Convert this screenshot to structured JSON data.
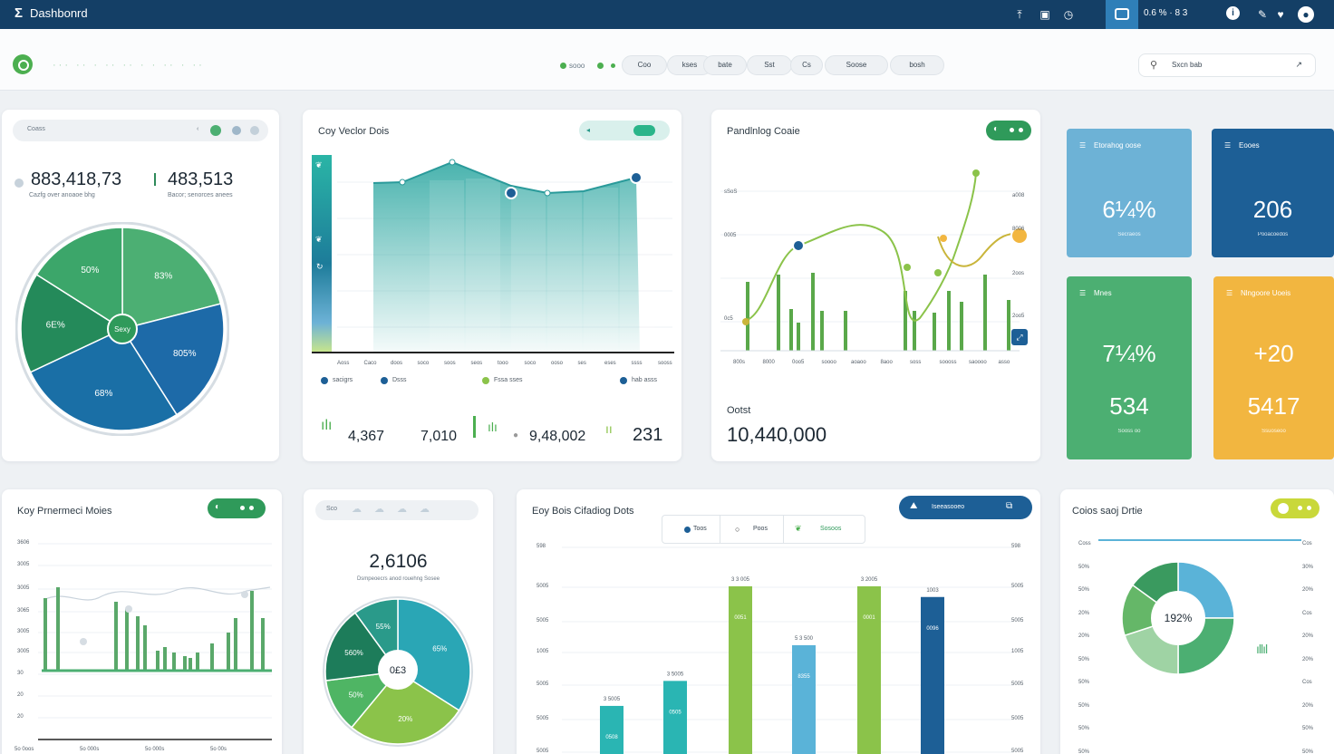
{
  "app": {
    "title": "Dashbonrd"
  },
  "topbar": {
    "status_text": "0.6 % · 8 3"
  },
  "subheader": {
    "blurred_text": "··· ·· · ·· ·· · · ·· · ··",
    "dot_label": "sooo",
    "pills": [
      "Coo",
      "kses",
      "bate",
      "Sst",
      "Cs",
      "Soose",
      "bosh"
    ],
    "search_placeholder": "Sxcn bab"
  },
  "card1": {
    "header_label": "Coass",
    "kpi_left": "883,418,73",
    "kpi_left_sub": "Cazfg over anoaoe bhg",
    "kpi_right": "483,513",
    "kpi_right_sub": "Bacor; senorces anees",
    "pie_center": "Sexy",
    "slices": [
      {
        "label": "83%",
        "value": 21,
        "color": "#4caf73"
      },
      {
        "label": "805%",
        "value": 20,
        "color": "#1d6aa8"
      },
      {
        "label": "68%",
        "value": 27,
        "color": "#1a6fa6"
      },
      {
        "label": "6E%",
        "value": 16,
        "color": "#248a5a"
      },
      {
        "label": "50%",
        "value": 16,
        "color": "#3ca66a"
      }
    ]
  },
  "card2": {
    "title": "Coy Veclor Dois",
    "x_ticks": [
      "Aoss",
      "Caco",
      "doos",
      "soco",
      "soos",
      "seos",
      "tooo",
      "soco",
      "ooso",
      "ses",
      "eses",
      "ssss",
      "sooss"
    ],
    "legend": [
      {
        "label": "sacigrs",
        "color": "#1d5f96"
      },
      {
        "label": "Dsss",
        "color": "#1d5f96"
      },
      {
        "label": "Fssa sses",
        "color": "#8bc34a"
      },
      {
        "label": "hab asss",
        "color": "#1d5f96"
      }
    ],
    "values": [
      "4,367",
      "7,010",
      "9,48,002",
      "231"
    ]
  },
  "card3": {
    "title": "Pandlnlog Coaie",
    "right_ticks": [
      "a008",
      "8006",
      "2oos",
      "2oo5"
    ],
    "left_ticks": [
      "sSoS",
      "0005",
      "0c5"
    ],
    "x_ticks": [
      "800s",
      "8000",
      "0oo5",
      "soooo",
      "aoaoo",
      "8aoo",
      "soss",
      "soooss",
      "saoooo",
      "asso"
    ],
    "caption": "Ootst",
    "bignum": "10,440,000"
  },
  "tiles": [
    {
      "label": "Etorahog oose",
      "main": "6¼%",
      "sub": "Secraeos",
      "color": "#6db2d6"
    },
    {
      "label": "Eooes",
      "main": "206",
      "sub": "Pooacoedos",
      "color": "#1d5f96"
    },
    {
      "label": "Mnes",
      "main": "7¼%",
      "main2": "534",
      "sub": "Sooss oo",
      "color": "#4caf72"
    },
    {
      "label": "Nlngoore Uoeis",
      "main": "+20",
      "main2": "5417",
      "sub": "Ssuoseoo",
      "color": "#f2b640"
    }
  ],
  "card4": {
    "title": "Koy Prnermeci Moies",
    "y_ticks": [
      "3606",
      "3005",
      "3005",
      "3065",
      "3005",
      "3005",
      "30",
      "20",
      "20"
    ],
    "x_ticks": [
      "5o 0oos",
      "5o 000s",
      "5o 000s",
      "5o 00s"
    ]
  },
  "card5": {
    "header_label": "Sco",
    "bignum": "2,6106",
    "sub": "Dsmpeoecrs anod rouehng Sosee",
    "pie_center": "0£3",
    "slices": [
      {
        "label": "65%",
        "value": 34,
        "color": "#2aa6b5"
      },
      {
        "label": "20%",
        "value": 27,
        "color": "#8bc34a"
      },
      {
        "label": "50%",
        "value": 12,
        "color": "#4fb564"
      },
      {
        "label": "560%",
        "value": 17,
        "color": "#1d7c5a"
      },
      {
        "label": "55%",
        "value": 10,
        "color": "#2a9a8a"
      }
    ]
  },
  "card6": {
    "title": "Eoy Bois Cifadiog Dots",
    "tabs": [
      "Toos",
      "Poos",
      "Sosoos"
    ],
    "action_label": "Iseeasooeo",
    "y_ticks": [
      "598",
      "5005",
      "5005",
      "1005",
      "5005",
      "5005",
      "5005"
    ],
    "bars": [
      {
        "value": 31,
        "label": "3 5005",
        "inner": "0508",
        "color": "#2ab5b3"
      },
      {
        "value": 45,
        "label": "3 5005",
        "inner": "0505",
        "color": "#2ab5b3"
      },
      {
        "value": 98,
        "label": "3 3 005",
        "inner": "0051",
        "color": "#8bc34a"
      },
      {
        "value": 65,
        "label": "5 3 500",
        "inner": "8355",
        "color": "#5ab3d8"
      },
      {
        "value": 98,
        "label": "3 2005",
        "inner": "0001",
        "color": "#8bc34a"
      },
      {
        "value": 92,
        "label": "1003",
        "inner": "0096",
        "color": "#1d5f96"
      }
    ]
  },
  "card7": {
    "title": "Coios saoj Drtie",
    "y_ticks": [
      "Coss",
      "50%",
      "50%",
      "20%",
      "20%",
      "50%",
      "50%",
      "50%",
      "50%",
      "50%"
    ],
    "y_ticks_right": [
      "Cos",
      "30%",
      "20%",
      "Cos",
      "20%",
      "20%",
      "Cos",
      "20%",
      "50%",
      "50%"
    ],
    "donut_center": "192%",
    "slices": [
      {
        "value": 25,
        "color": "#5ab3d8"
      },
      {
        "value": 25,
        "color": "#4caf72"
      },
      {
        "value": 20,
        "color": "#9fd3a4"
      },
      {
        "value": 15,
        "color": "#65b768"
      },
      {
        "value": 15,
        "color": "#3a9a5f"
      }
    ]
  }
}
